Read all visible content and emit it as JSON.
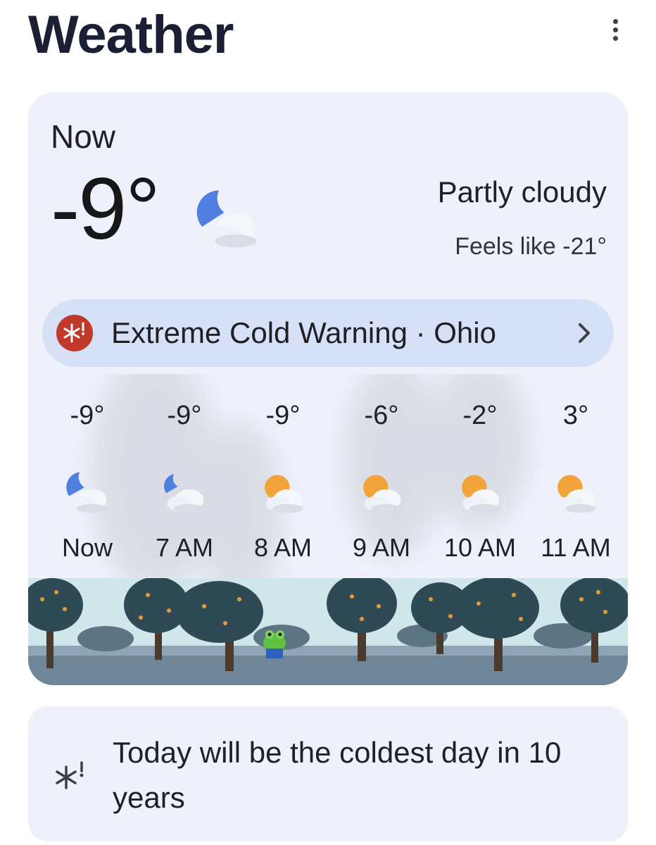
{
  "header": {
    "title": "Weather",
    "more_icon": "more-vert-icon"
  },
  "current": {
    "label": "Now",
    "temp": "-9°",
    "icon": "partly-cloudy-night-icon",
    "condition": "Partly cloudy",
    "feels_like": "Feels like -21°"
  },
  "alert": {
    "icon": "extreme-cold-icon",
    "text": "Extreme Cold Warning · Ohio",
    "chevron": "chevron-right-icon",
    "icon_color": "#c0392b"
  },
  "hourly": [
    {
      "temp": "-9°",
      "label": "Now",
      "icon": "partly-cloudy-night-icon"
    },
    {
      "temp": "-9°",
      "label": "7 AM",
      "icon": "partly-cloudy-night-icon"
    },
    {
      "temp": "-9°",
      "label": "8 AM",
      "icon": "partly-cloudy-day-icon"
    },
    {
      "temp": "-6°",
      "label": "9 AM",
      "icon": "partly-cloudy-day-icon"
    },
    {
      "temp": "-2°",
      "label": "10 AM",
      "icon": "partly-cloudy-day-icon"
    },
    {
      "temp": "3°",
      "label": "11 AM",
      "icon": "partly-cloudy-day-icon"
    }
  ],
  "insight": {
    "icon": "extreme-cold-icon",
    "text": "Today will be the coldest day in 10 years"
  },
  "colors": {
    "card_bg": "#eef1fa",
    "alert_bg": "#d6e0f6",
    "moon": "#4f7fe0",
    "sun": "#f2a43a"
  }
}
